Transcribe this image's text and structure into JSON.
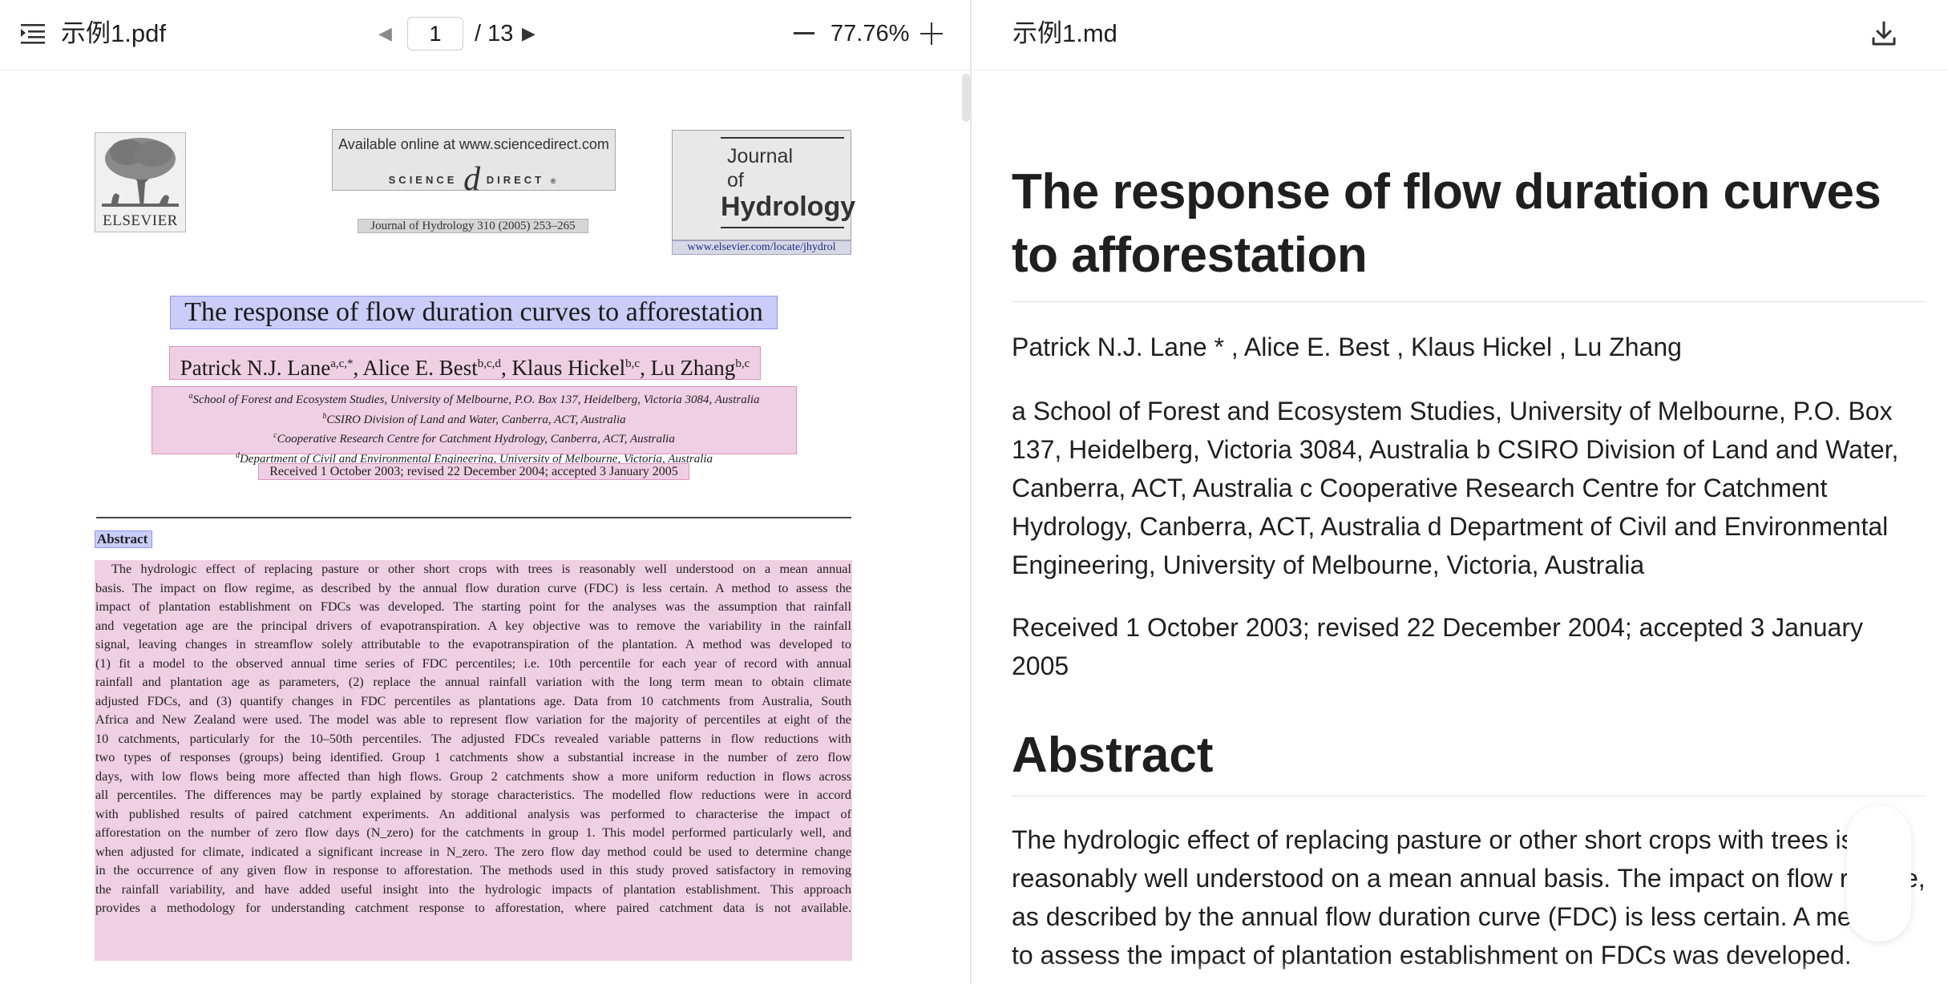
{
  "left": {
    "filename": "示例1.pdf",
    "page_current": "1",
    "page_total": "/ 13",
    "zoom": "77.76%",
    "icons": {
      "menu": "outline-menu-icon",
      "prev": "triangle-left-icon",
      "next": "triangle-right-icon",
      "zoom_out": "minus-icon",
      "zoom_in": "plus-icon"
    }
  },
  "pdf": {
    "elsevier": "ELSEVIER",
    "available_online": "Available online at www.sciencedirect.com",
    "sd_left": "SCIENCE",
    "sd_at": "d",
    "sd_right": "DIRECT",
    "journal_ref": "Journal of Hydrology 310 (2005) 253–265",
    "jh_journal": "Journal",
    "jh_of": "of",
    "jh_hydrology": "Hydrology",
    "jh_url": "www.elsevier.com/locate/jhydrol",
    "title": "The response of flow duration curves to afforestation",
    "authors": [
      {
        "name": "Patrick N.J. Lane",
        "sup": "a,c,*"
      },
      {
        "name": "Alice E. Best",
        "sup": "b,c,d"
      },
      {
        "name": "Klaus Hickel",
        "sup": "b,c"
      },
      {
        "name": "Lu Zhang",
        "sup": "b,c"
      }
    ],
    "affiliations": [
      {
        "sup": "a",
        "text": "School of Forest and Ecosystem Studies, University of Melbourne, P.O. Box 137, Heidelberg, Victoria 3084, Australia"
      },
      {
        "sup": "b",
        "text": "CSIRO Division of Land and Water, Canberra, ACT, Australia"
      },
      {
        "sup": "c",
        "text": "Cooperative Research Centre for Catchment Hydrology, Canberra, ACT, Australia"
      },
      {
        "sup": "d",
        "text": "Department of Civil and Environmental Engineering, University of Melbourne, Victoria, Australia"
      }
    ],
    "received": "Received 1 October 2003; revised 22 December 2004; accepted 3 January 2005",
    "abstract_heading": "Abstract",
    "abstract_lines": [
      "The hydrologic effect of replacing pasture or other short crops with trees is reasonably well understood on a mean annual",
      "basis. The impact on flow regime, as described by the annual flow duration curve (FDC) is less certain. A method to assess the",
      "impact of plantation establishment on FDCs was developed. The starting point for the analyses was the assumption that rainfall",
      "and vegetation age are the principal drivers of evapotranspiration. A key objective was to remove the variability in the rainfall",
      "signal, leaving changes in streamflow solely attributable to the evapotranspiration of the plantation. A method was developed to",
      "(1) fit a model to the observed annual time series of FDC percentiles; i.e. 10th percentile for each year of record with annual",
      "rainfall and plantation age as parameters, (2) replace the annual rainfall variation with the long term mean to obtain climate",
      "adjusted FDCs, and (3) quantify changes in FDC percentiles as plantations age. Data from 10 catchments from Australia, South",
      "Africa and New Zealand were used. The model was able to represent flow variation for the majority of percentiles at eight of the",
      "10 catchments, particularly for the 10–50th percentiles. The adjusted FDCs revealed variable patterns in flow reductions with",
      "two types of responses (groups) being identified. Group 1 catchments show a substantial increase in the number of zero flow",
      "days, with low flows being more affected than high flows. Group 2 catchments show a more uniform reduction in flows across",
      "all percentiles. The differences may be partly explained by storage characteristics. The modelled flow reductions were in accord",
      "with published results of paired catchment experiments. An additional analysis was performed to characterise the impact of",
      "afforestation on the number of zero flow days (N_zero) for the catchments in group 1. This model performed particularly well, and",
      "when adjusted for climate, indicated a significant increase in N_zero. The zero flow day method could be used to determine change",
      "in the occurrence of any given flow in response to afforestation. The methods used in this study proved satisfactory in removing",
      "the rainfall variability, and have added useful insight into the hydrologic impacts of plantation establishment. This approach",
      "provides a methodology for understanding catchment response to afforestation, where paired catchment data is not available."
    ]
  },
  "right": {
    "filename": "示例1.md",
    "icons": {
      "download": "download-icon"
    },
    "title": "The response of flow duration curves to afforestation",
    "authors": "Patrick N.J. Lane * , Alice E. Best , Klaus Hickel , Lu Zhang",
    "affiliations": "a School of Forest and Ecosystem Studies, University of Melbourne, P.O. Box 137, Heidelberg, Victoria 3084, Australia b CSIRO Division of Land and Water, Canberra, ACT, Australia c Cooperative Research Centre for Catchment Hydrology, Canberra, ACT, Australia d Department of Civil and Environmental Engineering, University of Melbourne, Victoria, Australia",
    "received": "Received 1 October 2003; revised 22 December 2004; accepted 3 January 2005",
    "abstract_heading": "Abstract",
    "abstract_text": "The hydrologic effect of replacing pasture or other short crops with trees is reasonably well understood on a mean annual basis. The impact on flow regime, as described by the annual flow duration curve (FDC) is less certain. A method to assess the impact of plantation establishment on FDCs was developed."
  },
  "colors": {
    "title_highlight": "#c9cdf7",
    "text_highlight": "#efcfe3",
    "text_highlight_border": "#e193c1"
  }
}
